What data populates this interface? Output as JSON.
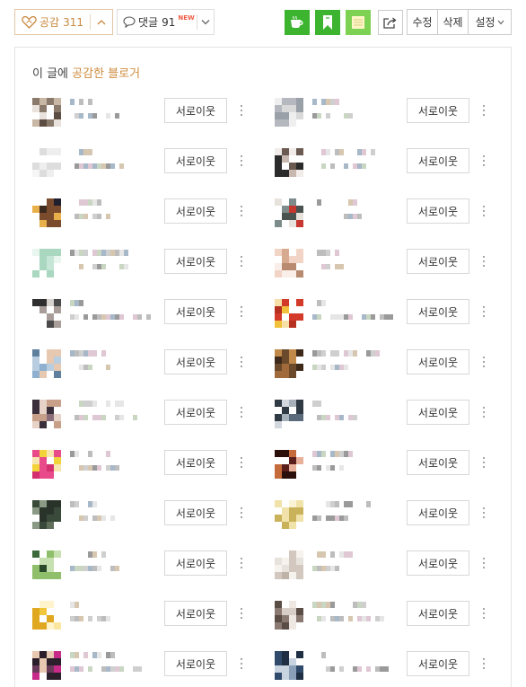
{
  "toolbar": {
    "like_label": "공감",
    "like_count": "311",
    "comment_label": "댓글",
    "comment_count": "91",
    "comment_new_badge": "NEW",
    "edit_label": "수정",
    "delete_label": "삭제",
    "settings_label": "설정",
    "colors": {
      "like": "#c8893e",
      "green": "#3db430",
      "light_green": "#7dd153",
      "new_badge": "#f05a44"
    }
  },
  "panel": {
    "title_prefix": "이 글에 ",
    "title_highlight": "공감한 블로거",
    "highlight_color": "#cf8c3e"
  },
  "bloggers": [
    {
      "follow_label": "서로이웃",
      "palette": [
        "#c9b7a6",
        "#8a7a6c",
        "#e9e2dc",
        "#5c4d42"
      ]
    },
    {
      "follow_label": "서로이웃",
      "palette": [
        "#d9d9d9",
        "#b5b8bf",
        "#efefef",
        "#9aa0a8"
      ]
    },
    {
      "follow_label": "서로이웃",
      "palette": [
        "#eeeeee",
        "#dddddd",
        "#f6f6f6",
        "#c8c8c8"
      ]
    },
    {
      "follow_label": "서로이웃",
      "palette": [
        "#2b2b2b",
        "#c9b8b0",
        "#f1ece9",
        "#6b5a52"
      ]
    },
    {
      "follow_label": "서로이웃",
      "palette": [
        "#3d2a1e",
        "#e8b04a",
        "#7a4b2c",
        "#1f1f2e"
      ]
    },
    {
      "follow_label": "서로이웃",
      "palette": [
        "#7d8c8a",
        "#c6372f",
        "#e7e2dc",
        "#4a5250"
      ]
    },
    {
      "follow_label": "서로이웃",
      "palette": [
        "#c5e6d6",
        "#a9d7c0",
        "#e9f5ef",
        "#8fc5aa"
      ]
    },
    {
      "follow_label": "서로이웃",
      "palette": [
        "#f2d4c7",
        "#d7a98e",
        "#faeee8",
        "#b88a70"
      ]
    },
    {
      "follow_label": "서로이웃",
      "palette": [
        "#4a4a4a",
        "#a89d98",
        "#d8d2cf",
        "#2f2f2f"
      ]
    },
    {
      "follow_label": "서로이웃",
      "palette": [
        "#d43a2a",
        "#f2c13c",
        "#f7e0a8",
        "#b5301f"
      ]
    },
    {
      "follow_label": "서로이웃",
      "palette": [
        "#8fb0cf",
        "#e7c9b2",
        "#b8cde0",
        "#5f7f9f"
      ]
    },
    {
      "follow_label": "서로이웃",
      "palette": [
        "#6a4a2a",
        "#c28a4a",
        "#3e2a1a",
        "#a06a3a"
      ]
    },
    {
      "follow_label": "서로이웃",
      "palette": [
        "#3a2f3a",
        "#c8a08a",
        "#8a6f7a",
        "#e6d2c6"
      ]
    },
    {
      "follow_label": "서로이웃",
      "palette": [
        "#5a6a7a",
        "#a5b0bb",
        "#2f3a44",
        "#d2d8de"
      ]
    },
    {
      "follow_label": "서로이웃",
      "palette": [
        "#e84a8a",
        "#f2d33a",
        "#f7e6b0",
        "#d2306e"
      ]
    },
    {
      "follow_label": "서로이웃",
      "palette": [
        "#5a1f1a",
        "#c56a3a",
        "#2a0f0a",
        "#e8b09a"
      ]
    },
    {
      "follow_label": "서로이웃",
      "palette": [
        "#3a4a3a",
        "#5f6f5a",
        "#2a332a",
        "#8a9a85"
      ]
    },
    {
      "follow_label": "서로이웃",
      "palette": [
        "#f0e2a8",
        "#e7d07a",
        "#faf3d6",
        "#c9b25a"
      ]
    },
    {
      "follow_label": "서로이웃",
      "palette": [
        "#3d6a3a",
        "#8fbf6a",
        "#2a4a2a",
        "#c6e0b0"
      ]
    },
    {
      "follow_label": "서로이웃",
      "palette": [
        "#e8e2dc",
        "#d2c8bf",
        "#f6f2ee",
        "#bfb3a8"
      ]
    },
    {
      "follow_label": "서로이웃",
      "palette": [
        "#f2c63a",
        "#fbe6a0",
        "#e0a820",
        "#fff4cc"
      ]
    },
    {
      "follow_label": "서로이웃",
      "palette": [
        "#8a7a72",
        "#d8cfc8",
        "#5a4d46",
        "#efe8e2"
      ]
    },
    {
      "follow_label": "서로이웃",
      "palette": [
        "#2a1f2a",
        "#c82a8a",
        "#e8c8b0",
        "#6a3a5a"
      ]
    },
    {
      "follow_label": "서로이웃",
      "palette": [
        "#2f4a6a",
        "#8aa0b8",
        "#1f2f44",
        "#c8d4e0"
      ]
    }
  ],
  "line_palette": [
    "#e6e6e6",
    "#cfcfcf",
    "#bdbdbd",
    "#a7b8c9",
    "#d8c7b0",
    "#9a9a9a",
    "#c9d6c2",
    "#e0c7d4"
  ]
}
